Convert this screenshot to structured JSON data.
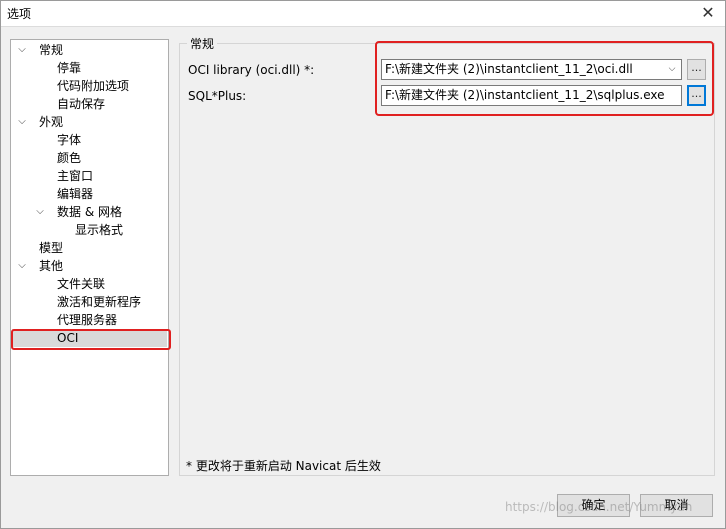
{
  "window": {
    "title": "选项",
    "close_glyph": "✕"
  },
  "tree": {
    "items": [
      {
        "label": "常规",
        "expanded": true
      },
      {
        "label": "停靠"
      },
      {
        "label": "代码附加选项"
      },
      {
        "label": "自动保存"
      },
      {
        "label": "外观",
        "expanded": true
      },
      {
        "label": "字体"
      },
      {
        "label": "颜色"
      },
      {
        "label": "主窗口"
      },
      {
        "label": "编辑器"
      },
      {
        "label": "数据 & 网格",
        "expanded": true
      },
      {
        "label": "显示格式"
      },
      {
        "label": "模型"
      },
      {
        "label": "其他",
        "expanded": true
      },
      {
        "label": "文件关联"
      },
      {
        "label": "激活和更新程序"
      },
      {
        "label": "代理服务器"
      },
      {
        "label": "OCI",
        "selected": true
      }
    ]
  },
  "panel": {
    "group_label": "常规",
    "oci_label": "OCI library (oci.dll) *:",
    "oci_value": "F:\\新建文件夹 (2)\\instantclient_11_2\\oci.dll",
    "sqlplus_label": "SQL*Plus:",
    "sqlplus_value": "F:\\新建文件夹 (2)\\instantclient_11_2\\sqlplus.exe",
    "browse_label": "...",
    "note": "* 更改将于重新启动 Navicat 后生效"
  },
  "buttons": {
    "ok": "确定",
    "cancel": "取消"
  },
  "watermark": "https://blog.csdn.net/Yummyan",
  "colors": {
    "highlight": "#e02020",
    "focus": "#0078d7"
  }
}
